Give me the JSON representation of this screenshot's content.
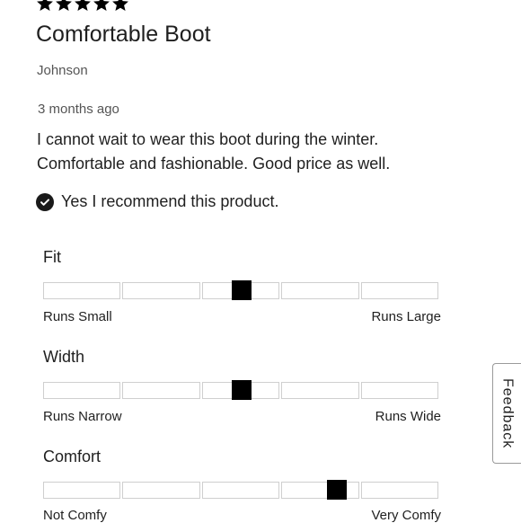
{
  "review": {
    "rating": 5,
    "title": "Comfortable Boot",
    "author": "Johnson",
    "date": "3 months ago",
    "body": "I cannot wait to wear this boot during the winter. Comfortable and fashionable. Good price as well.",
    "recommend_text": "Yes I recommend this product."
  },
  "ratings": [
    {
      "label": "Fit",
      "min_label": "Runs Small",
      "max_label": "Runs Large",
      "segments": 5,
      "value_position": 0.5
    },
    {
      "label": "Width",
      "min_label": "Runs Narrow",
      "max_label": "Runs Wide",
      "segments": 5,
      "value_position": 0.5
    },
    {
      "label": "Comfort",
      "min_label": "Not Comfy",
      "max_label": "Very Comfy",
      "segments": 5,
      "value_position": 0.74
    }
  ],
  "feedback_tab": {
    "label": "Feedback"
  },
  "colors": {
    "star": "#000000",
    "marker": "#000000",
    "segment_border": "#cfcfcf"
  },
  "icons": {
    "star": "star-icon",
    "check": "check-circle-icon"
  }
}
